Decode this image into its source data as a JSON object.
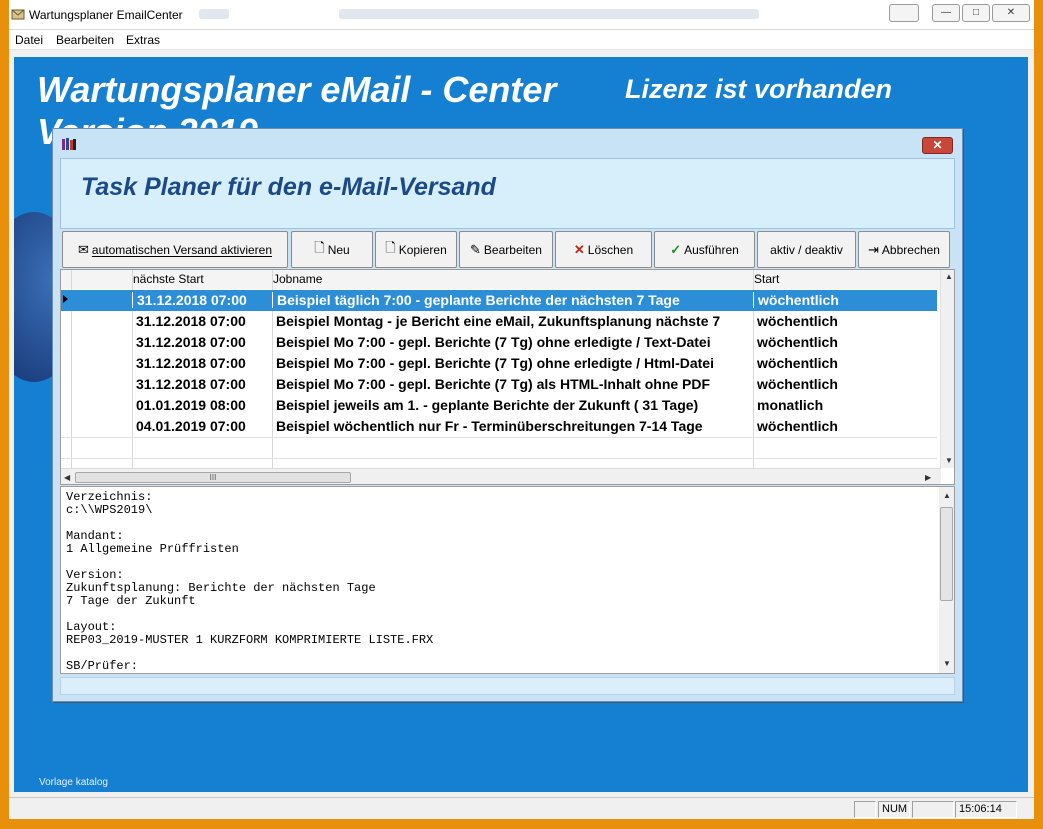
{
  "window": {
    "title": "Wartungsplaner EmailCenter",
    "controls": {
      "minimize": "—",
      "maximize": "□",
      "close": "✕"
    }
  },
  "menu": [
    "Datei",
    "Bearbeiten",
    "Extras"
  ],
  "background": {
    "heading": "Wartungsplaner eMail - Center",
    "heading_line2": "Version 2019",
    "license": "Lizenz ist vorhanden",
    "footer_note": "Vorlage katalog",
    "colors": {
      "page_bg": "#1580d2",
      "frame": "#e8900c"
    }
  },
  "dialog": {
    "heading": "Task Planer für den e-Mail-Versand",
    "close_label": "✕",
    "toolbar": [
      {
        "label": "automatischen Versand aktivieren",
        "icon": "envelope-icon"
      },
      {
        "label": "Neu",
        "icon": "new-document-icon"
      },
      {
        "label": "Kopieren",
        "icon": "copy-document-icon"
      },
      {
        "label": "Bearbeiten",
        "icon": "edit-icon"
      },
      {
        "label": "Löschen",
        "icon": "delete-x-icon"
      },
      {
        "label": "Ausführen",
        "icon": "checkmark-icon"
      },
      {
        "label": "aktiv / deaktiv",
        "icon": ""
      },
      {
        "label": "Abbrechen",
        "icon": "exit-door-icon"
      }
    ],
    "grid": {
      "columns": [
        "nächste Start",
        "Jobname",
        "Start"
      ],
      "rows": [
        {
          "next_start": "31.12.2018 07:00",
          "jobname": "Beispiel täglich 7:00 - geplante Berichte der nächsten 7 Tage",
          "start": "wöchentlich",
          "selected": true
        },
        {
          "next_start": "31.12.2018 07:00",
          "jobname": "Beispiel Montag - je Bericht eine eMail, Zukunftsplanung nächste 7",
          "start": "wöchentlich"
        },
        {
          "next_start": "31.12.2018 07:00",
          "jobname": "Beispiel Mo 7:00 - gepl. Berichte (7 Tg)  ohne erledigte / Text-Datei",
          "start": "wöchentlich"
        },
        {
          "next_start": "31.12.2018 07:00",
          "jobname": "Beispiel Mo 7:00 - gepl. Berichte (7 Tg)  ohne erledigte / Html-Datei",
          "start": "wöchentlich"
        },
        {
          "next_start": "31.12.2018 07:00",
          "jobname": "Beispiel Mo 7:00 - gepl. Berichte (7 Tg)  als HTML-Inhalt ohne PDF",
          "start": "wöchentlich"
        },
        {
          "next_start": "01.01.2019 08:00",
          "jobname": "Beispiel jeweils am 1. - geplante Berichte der Zukunft ( 31 Tage)",
          "start": "monatlich"
        },
        {
          "next_start": "04.01.2019 07:00",
          "jobname": "Beispiel wöchentlich nur Fr - Terminüberschreitungen 7-14 Tage",
          "start": "wöchentlich"
        }
      ],
      "hscroll_thumb": "III"
    },
    "details_text": "Verzeichnis:\nc:\\\\WPS2019\\\n\nMandant:\n1 Allgemeine Prüffristen\n\nVersion:\nZukunftsplanung: Berichte der nächsten Tage\n7 Tage der Zukunft\n\nLayout:\nREP03_2019-MUSTER 1 KURZFORM KOMPRIMIERTE LISTE.FRX\n\nSB/Prüfer:"
  },
  "statusbar": {
    "num": "NUM",
    "time": "15:06:14"
  }
}
